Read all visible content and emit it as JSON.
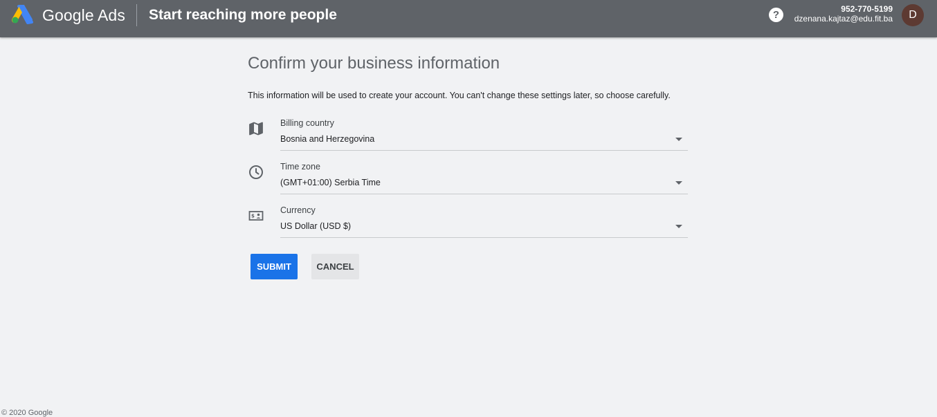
{
  "header": {
    "brand": "Google Ads",
    "title": "Start reaching more people",
    "help_icon": "help-circle-icon",
    "account_phone": "952-770-5199",
    "account_email": "dzenana.kajtaz@edu.fit.ba",
    "avatar_initial": "D",
    "avatar_color": "#5d3a32",
    "bar_color": "#5f6368"
  },
  "main": {
    "title": "Confirm your business information",
    "description": "This information will be used to create your account. You can't change these settings later, so choose carefully.",
    "fields": [
      {
        "label": "Billing country",
        "value": "Bosnia and Herzegovina",
        "icon": "map-icon"
      },
      {
        "label": "Time zone",
        "value": "(GMT+01:00) Serbia Time",
        "icon": "clock-icon"
      },
      {
        "label": "Currency",
        "value": "US Dollar (USD $)",
        "icon": "currency-icon"
      }
    ],
    "submit_label": "SUBMIT",
    "cancel_label": "CANCEL",
    "accent_color": "#1a73e8"
  },
  "footer": {
    "text": "© 2020 Google"
  }
}
